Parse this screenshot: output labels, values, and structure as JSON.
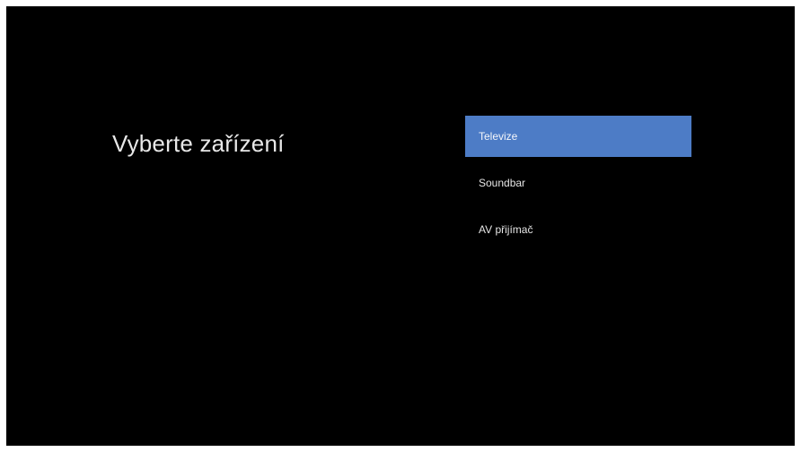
{
  "screen": {
    "title": "Vyberte zařízení"
  },
  "menu": {
    "items": [
      {
        "label": "Televize",
        "selected": true
      },
      {
        "label": "Soundbar",
        "selected": false
      },
      {
        "label": "AV přijímač",
        "selected": false
      }
    ]
  },
  "colors": {
    "background": "#000000",
    "selected_item": "#4d7cc6",
    "text": "#e6e6e6"
  }
}
